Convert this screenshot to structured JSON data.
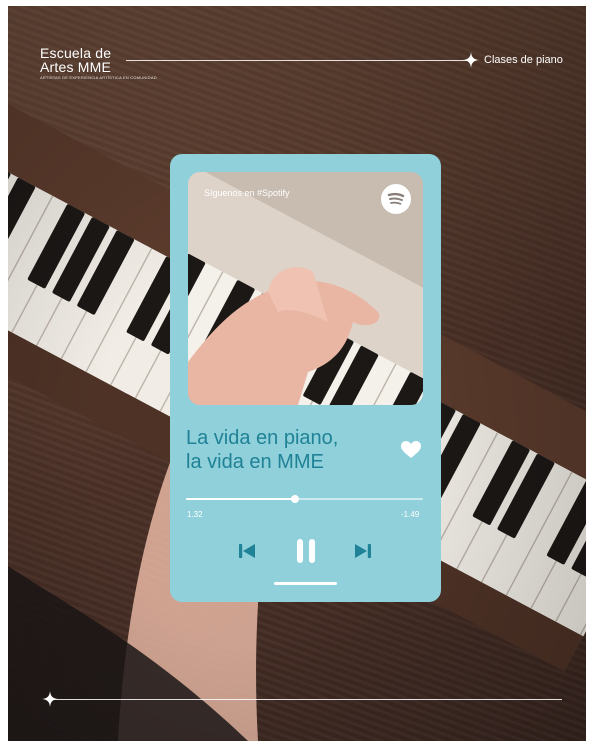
{
  "brand": {
    "line1": "Escuela de",
    "line2": "Artes MME",
    "tagline": "ARTISTAS DE EXPERIENCIA ARTÍSTICA EN COMUNIDAD"
  },
  "header": {
    "label": "Clases de piano"
  },
  "player": {
    "follow_text": "Síguenos en #Spotify",
    "title_line1": "La vida en piano,",
    "title_line2": "la vida en MME",
    "elapsed": "1.32",
    "remaining": "-1.49",
    "progress": 0.46
  },
  "colors": {
    "card": "#8fd0da",
    "title": "#1f8296",
    "controls": "#1f8296",
    "white": "#ffffff"
  },
  "icons": {
    "spotify": "spotify-icon",
    "heart": "heart-icon",
    "previous": "skip-previous-icon",
    "pause": "pause-icon",
    "next": "skip-next-icon",
    "sparkle": "sparkle-star-icon"
  }
}
